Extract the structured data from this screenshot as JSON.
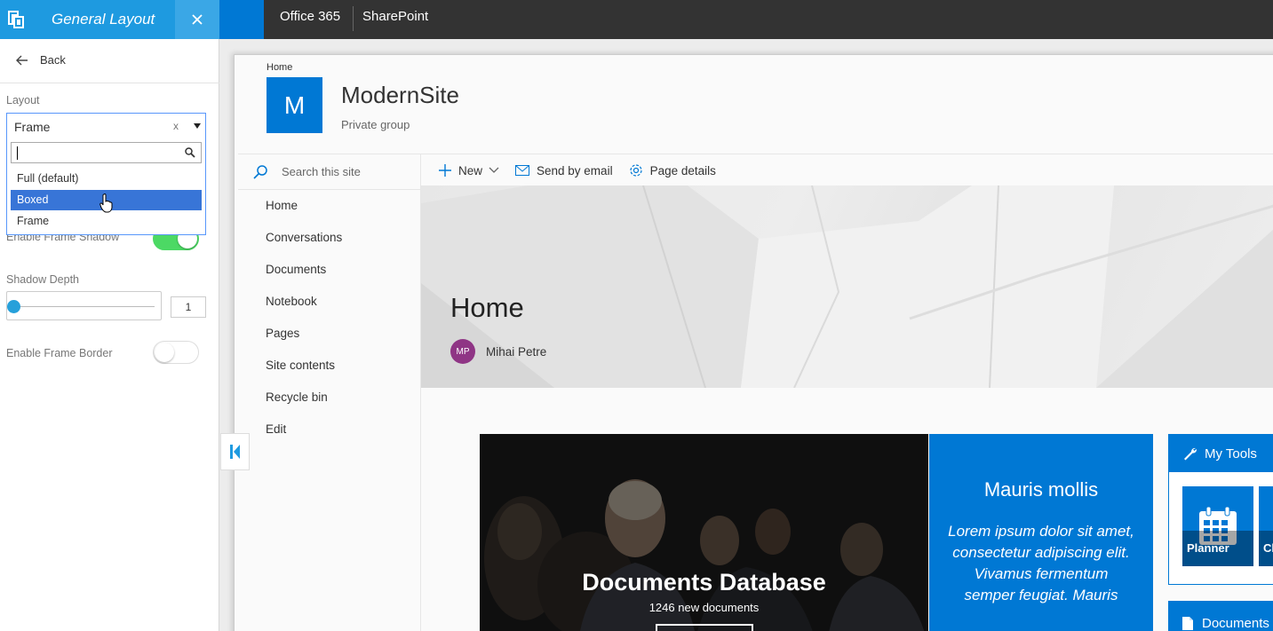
{
  "panel": {
    "title": "General Layout",
    "back_label": "Back",
    "layout_label": "Layout",
    "layout_selected": "Frame",
    "layout_clear": "x",
    "search_value": "",
    "options": [
      "Full (default)",
      "Boxed",
      "Frame"
    ],
    "highlighted_option": "Boxed",
    "enable_frame_shadow_label": "Enable Frame Shadow",
    "enable_frame_shadow": true,
    "shadow_depth_label": "Shadow Depth",
    "shadow_depth_value": "1",
    "enable_frame_border_label": "Enable Frame Border",
    "enable_frame_border": false
  },
  "suite_bar": {
    "office": "Office 365",
    "app": "SharePoint"
  },
  "site": {
    "breadcrumb": "Home",
    "logo_letter": "M",
    "title": "ModernSite",
    "subtitle": "Private group",
    "search_placeholder": "Search this site",
    "nav": [
      "Home",
      "Conversations",
      "Documents",
      "Notebook",
      "Pages",
      "Site contents",
      "Recycle bin",
      "Edit"
    ],
    "commands": {
      "new": "New",
      "send": "Send by email",
      "details": "Page details"
    },
    "page_title": "Home",
    "author_initials": "MP",
    "author_name": "Mihai Petre"
  },
  "tiles": {
    "doc_title": "Documents Database",
    "doc_sub": "1246 new documents",
    "blue_title": "Mauris mollis",
    "blue_body": "Lorem ipsum dolor sit amet, consectetur adipiscing elit. Vivamus fermentum semper feugiat. Mauris",
    "tools_title": "My Tools",
    "tool1": "Planner",
    "tool2": "Cl",
    "docs2_title": "Documents"
  },
  "colors": {
    "accent": "#0078d4",
    "panel_header": "#1e9ae0",
    "highlight": "#3875d7",
    "toggle_on": "#4cd964",
    "avatar": "#8f3585"
  }
}
